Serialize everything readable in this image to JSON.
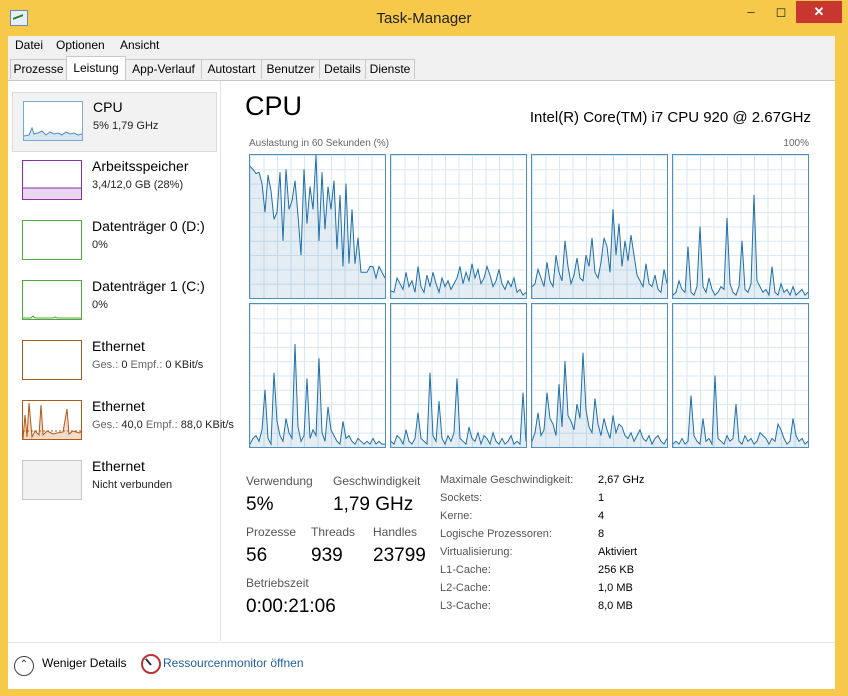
{
  "window": {
    "title": "Task-Manager",
    "icon": "task-manager-icon",
    "controls": {
      "minimize": "–",
      "maximize": "◻",
      "close": "✕"
    }
  },
  "menu": [
    "Datei",
    "Optionen",
    "Ansicht"
  ],
  "tabs": [
    "Prozesse",
    "Leistung",
    "App-Verlauf",
    "Autostart",
    "Benutzer",
    "Details",
    "Dienste"
  ],
  "active_tab": "Leistung",
  "sidebar": [
    {
      "name": "CPU",
      "sub_value": "5%  1,79 GHz",
      "color": "#4f8fbf"
    },
    {
      "name": "Arbeitsspeicher",
      "sub_value": "3,4/12,0 GB (28%)",
      "color": "#8b2fa8"
    },
    {
      "name": "Datenträger 0 (D:)",
      "sub_value": "0%",
      "color": "#4ea83a"
    },
    {
      "name": "Datenträger 1 (C:)",
      "sub_value": "0%",
      "color": "#4ea83a"
    },
    {
      "name": "Ethernet",
      "sub_prefix1": "Ges.:",
      "sub_val1": "0",
      "sub_prefix2": "Empf.:",
      "sub_val2": "0 KBit/s",
      "color": "#b05a1a"
    },
    {
      "name": "Ethernet",
      "sub_prefix1": "Ges.:",
      "sub_val1": "40,0",
      "sub_prefix2": "Empf.:",
      "sub_val2": "88,0 KBit/s",
      "color": "#b05a1a"
    },
    {
      "name": "Ethernet",
      "sub_value": "Nicht verbunden",
      "color": "#b0b0b0"
    }
  ],
  "main": {
    "title": "CPU",
    "model": "Intel(R) Core(TM) i7 CPU 920 @ 2.67GHz",
    "graph_label": "Auslastung in 60 Sekunden (%)",
    "graph_max": "100%",
    "graph_color": "#1f6fa8",
    "cores": [
      [
        92,
        90,
        87,
        88,
        80,
        60,
        86,
        75,
        55,
        60,
        88,
        40,
        90,
        62,
        68,
        82,
        58,
        30,
        90,
        52,
        78,
        62,
        100,
        40,
        88,
        48,
        78,
        62,
        82,
        34,
        72,
        22,
        80,
        24,
        62,
        24,
        42,
        18,
        18,
        18,
        22,
        22,
        14,
        22,
        18,
        14
      ],
      [
        5,
        4,
        14,
        10,
        6,
        18,
        8,
        12,
        4,
        22,
        8,
        4,
        16,
        8,
        18,
        10,
        4,
        14,
        8,
        12,
        6,
        10,
        14,
        22,
        10,
        18,
        12,
        24,
        14,
        20,
        10,
        14,
        22,
        16,
        8,
        12,
        20,
        10,
        6,
        12,
        8,
        14,
        4,
        6,
        2,
        4
      ],
      [
        8,
        10,
        20,
        14,
        8,
        25,
        12,
        8,
        30,
        18,
        12,
        40,
        22,
        10,
        16,
        28,
        14,
        12,
        30,
        22,
        42,
        18,
        14,
        25,
        42,
        36,
        18,
        62,
        30,
        52,
        22,
        40,
        26,
        44,
        30,
        16,
        12,
        8,
        24,
        10,
        8,
        16,
        6,
        4,
        20,
        10
      ],
      [
        2,
        4,
        12,
        6,
        4,
        36,
        4,
        2,
        8,
        50,
        8,
        4,
        14,
        6,
        2,
        4,
        8,
        6,
        56,
        10,
        4,
        2,
        8,
        40,
        6,
        4,
        10,
        72,
        12,
        8,
        4,
        6,
        2,
        22,
        4,
        2,
        10,
        4,
        6,
        2,
        8,
        2,
        4,
        6,
        2,
        4
      ],
      [
        2,
        6,
        8,
        4,
        12,
        40,
        6,
        2,
        52,
        18,
        8,
        4,
        20,
        10,
        6,
        72,
        14,
        4,
        8,
        48,
        6,
        12,
        8,
        62,
        10,
        4,
        28,
        12,
        8,
        4,
        2,
        18,
        6,
        8,
        4,
        2,
        6,
        4,
        2,
        4,
        2,
        6,
        2,
        4,
        2,
        2
      ],
      [
        4,
        2,
        8,
        6,
        2,
        12,
        4,
        2,
        6,
        24,
        6,
        4,
        2,
        52,
        8,
        4,
        32,
        6,
        2,
        8,
        4,
        10,
        48,
        6,
        4,
        2,
        14,
        6,
        4,
        10,
        2,
        8,
        6,
        2,
        10,
        4,
        2,
        6,
        2,
        4,
        8,
        2,
        4,
        2,
        38,
        4
      ],
      [
        4,
        10,
        24,
        8,
        12,
        38,
        20,
        16,
        8,
        44,
        14,
        60,
        22,
        18,
        12,
        30,
        20,
        66,
        26,
        14,
        10,
        34,
        16,
        8,
        20,
        12,
        6,
        22,
        10,
        16,
        14,
        8,
        6,
        10,
        4,
        8,
        12,
        6,
        4,
        8,
        2,
        6,
        8,
        4,
        2,
        6
      ],
      [
        2,
        4,
        2,
        6,
        2,
        4,
        36,
        8,
        4,
        2,
        20,
        4,
        6,
        2,
        50,
        6,
        4,
        2,
        8,
        4,
        6,
        30,
        4,
        2,
        8,
        4,
        6,
        2,
        4,
        10,
        8,
        6,
        2,
        6,
        4,
        16,
        12,
        6,
        2,
        4,
        20,
        8,
        4,
        6,
        2,
        4
      ]
    ],
    "stats": {
      "usage_label": "Verwendung",
      "usage_value": "5%",
      "speed_label": "Geschwindigkeit",
      "speed_value": "1,79 GHz",
      "processes_label": "Prozesse",
      "processes_value": "56",
      "threads_label": "Threads",
      "threads_value": "939",
      "handles_label": "Handles",
      "handles_value": "23799",
      "uptime_label": "Betriebszeit",
      "uptime_value": "0:00:21:06"
    },
    "specs": [
      {
        "key": "Maximale Geschwindigkeit:",
        "value": "2,67 GHz"
      },
      {
        "key": "Sockets:",
        "value": "1"
      },
      {
        "key": "Kerne:",
        "value": "4"
      },
      {
        "key": "Logische Prozessoren:",
        "value": "8"
      },
      {
        "key": "Virtualisierung:",
        "value": "Aktiviert"
      },
      {
        "key": "L1-Cache:",
        "value": "256 KB"
      },
      {
        "key": "L2-Cache:",
        "value": "1,0 MB"
      },
      {
        "key": "L3-Cache:",
        "value": "8,0 MB"
      }
    ]
  },
  "footer": {
    "fewer_details": "Weniger Details",
    "resource_monitor": "Ressourcenmonitor öffnen"
  }
}
